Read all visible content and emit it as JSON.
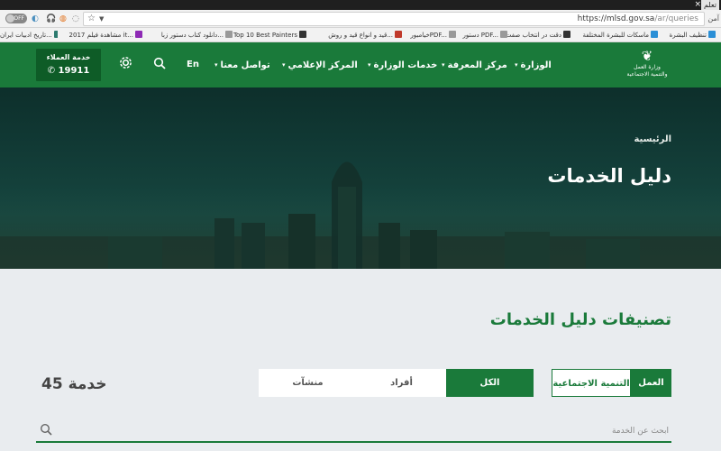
{
  "browser": {
    "tab_title": "تعلم",
    "window_close_label": "×",
    "secure_label": "آمن",
    "url_host": "https://mlsd.gov.sa",
    "url_path": "/ar/queries",
    "toggle_label": "OFF",
    "bookmarks": [
      {
        "label": "تنظيف البشرة",
        "icon": "bookmark-icon"
      },
      {
        "label": "ماسكات للبشرة المختلفة",
        "icon": "bookmark-icon"
      },
      {
        "label": "دقت در انتخاب صفت",
        "icon": "bookmark-icon"
      },
      {
        "label": "دستور PDF...",
        "icon": "bookmark-icon"
      },
      {
        "label": "خیامبورPDF...",
        "icon": "bookmark-icon"
      },
      {
        "label": "قيد و انواع قيد و روش...",
        "icon": "bookmark-icon"
      },
      {
        "label": "Top 10 Best Painters",
        "icon": "bookmark-icon"
      },
      {
        "label": "دانلود کتاب دستور زبا...",
        "icon": "bookmark-icon"
      },
      {
        "label": "مشاهدة فيلم 2017 it...",
        "icon": "bookmark-icon"
      },
      {
        "label": "تاریخ ادبیات ایران...",
        "icon": "bookmark-icon"
      }
    ]
  },
  "header": {
    "logo_line1": "وزارة العمل",
    "logo_line2": "والتنمية الاجتماعية",
    "nav": {
      "ministry": "الوزارة",
      "knowledge": "مركز المعرفة",
      "services": "خدمات الوزارة",
      "media": "المركز الإعلامي",
      "contact": "تواصل معنا",
      "lang": "En"
    },
    "customer_service": {
      "title": "خدمة العملاء",
      "number": "19911"
    },
    "icons": {
      "search": "search-icon",
      "settings": "gear-icon",
      "phone": "phone-icon"
    }
  },
  "hero": {
    "breadcrumb": "الرئيسية",
    "title": "دليل الخدمات"
  },
  "main": {
    "section_title": "تصنيفات دليل الخدمات",
    "categories": {
      "work": "العمل",
      "social": "التنمية الاجتماعية"
    },
    "filters": {
      "all": "الكل",
      "individuals": "أفراد",
      "establishments": "منشآت"
    },
    "count_number": "45",
    "count_unit": "خدمة",
    "search_placeholder": "ابحث عن الخدمة"
  },
  "colors": {
    "brand_green": "#1a7a3a",
    "dark_green": "#0e5c27",
    "page_bg": "#e9ecef"
  }
}
